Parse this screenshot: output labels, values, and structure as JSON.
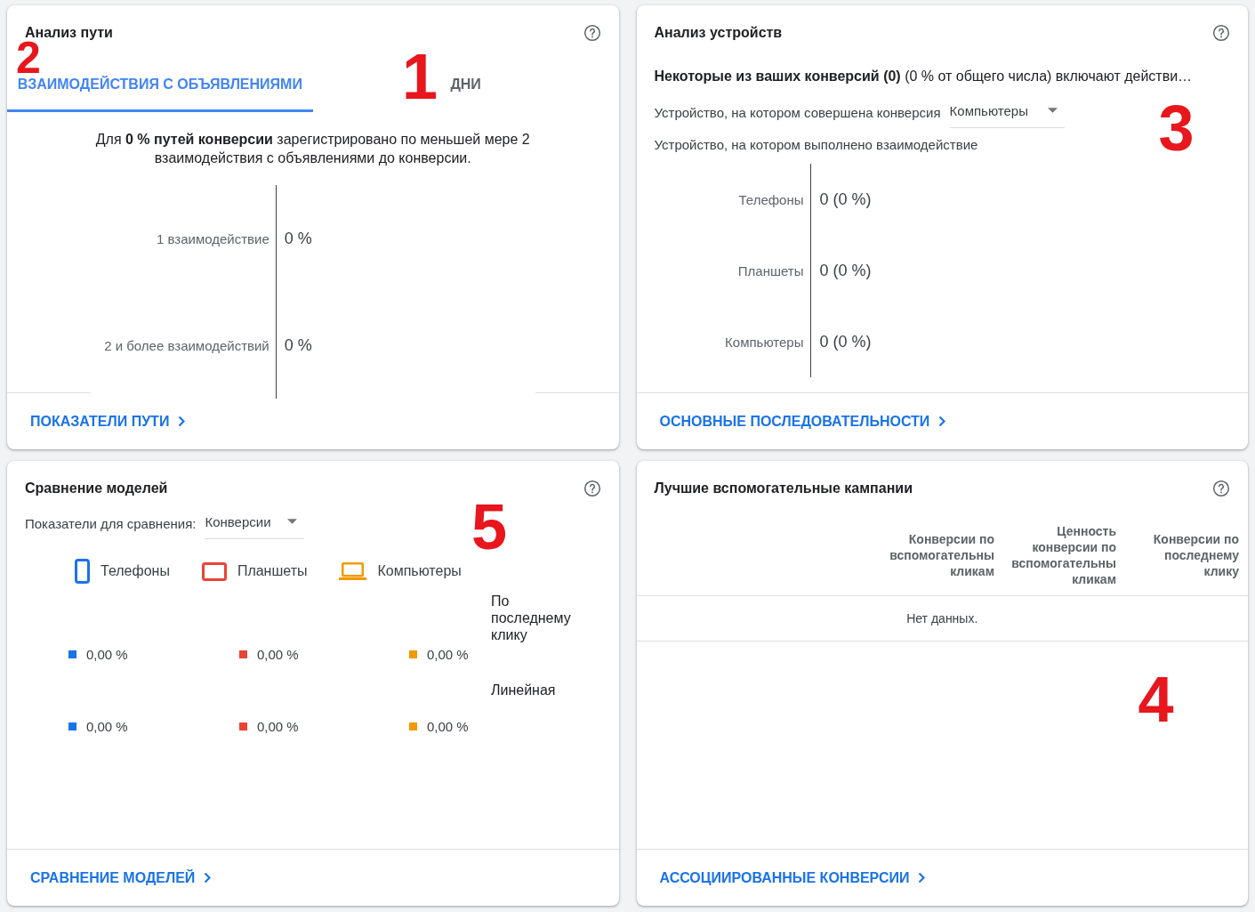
{
  "path_analysis": {
    "title": "Анализ пути",
    "tabs": [
      {
        "label": "ВЗАИМОДЕЙСТВИЯ С ОБЪЯВЛЕНИЯМИ",
        "selected": true
      },
      {
        "label": "ДНИ",
        "selected": false
      }
    ],
    "description": "Для **0 % путей конверсии** зарегистрировано по меньшей мере 2 взаимодействия с объявлениями до конверсии.",
    "rows": [
      {
        "label": "1 взаимодействие",
        "value": "0 %"
      },
      {
        "label": "2 и более взаимодействий",
        "value": "0 %"
      }
    ],
    "footer_link": "ПОКАЗАТЕЛИ ПУТИ",
    "annotations": [
      "2",
      "1"
    ]
  },
  "device_analysis": {
    "title": "Анализ устройств",
    "summary": "**Некоторые из ваших конверсий (0)** (0 % от общего числа) включают действи…",
    "conversion_device": {
      "label": "Устройство, на котором совершена конверсия",
      "value": "Компьютеры"
    },
    "interaction_device_label": "Устройство, на котором выполнено взаимодействие",
    "rows": [
      {
        "label": "Телефоны",
        "value": "0 (0 %)"
      },
      {
        "label": "Планшеты",
        "value": "0 (0 %)"
      },
      {
        "label": "Компьютеры",
        "value": "0 (0 %)"
      }
    ],
    "footer_link": "ОСНОВНЫЕ ПОСЛЕДОВАТЕЛЬНОСТИ",
    "annotations": [
      "3"
    ]
  },
  "model_comparison": {
    "title": "Сравнение моделей",
    "metric": {
      "label": "Показатели для сравнения:",
      "value": "Конверсии"
    },
    "devices": [
      {
        "name": "Телефоны",
        "kind": "phone",
        "color": "#1a73e8"
      },
      {
        "name": "Планшеты",
        "kind": "tablet",
        "color": "#ea4335"
      },
      {
        "name": "Компьютеры",
        "kind": "laptop",
        "color": "#f29900"
      }
    ],
    "models": [
      {
        "name": "По последнему клику",
        "values": [
          "0,00 %",
          "0,00 %",
          "0,00 %"
        ]
      },
      {
        "name": "Линейная",
        "values": [
          "0,00 %",
          "0,00 %",
          "0,00 %"
        ]
      }
    ],
    "footer_link": "СРАВНЕНИЕ МОДЕЛЕЙ",
    "annotations": [
      "5"
    ]
  },
  "top_assisting_campaigns": {
    "title": "Лучшие вспомогательные кампании",
    "table": {
      "columns": [
        "Конверсии по вспомогательны кликам",
        "Ценность конверсии по вспомогательны кликам",
        "Конверсии по последнему клику"
      ],
      "empty_message": "Нет данных."
    },
    "footer_link": "АССОЦИИРОВАННЫЕ КОНВЕРСИИ",
    "annotations": [
      "4"
    ]
  }
}
